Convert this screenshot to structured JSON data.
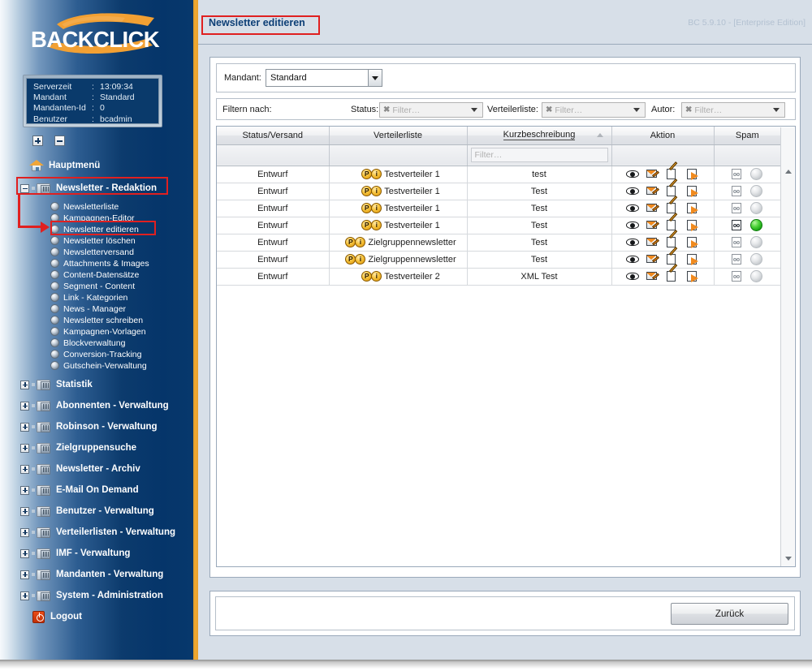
{
  "brand": {
    "logo_text": "BACKCLICK",
    "accent_orange": "#f0a63a",
    "dark_blue": "#05356a",
    "annotation_red": "#e02020"
  },
  "sidebar": {
    "info": [
      {
        "key": "Serverzeit",
        "sep": ":",
        "value": "13:09:34"
      },
      {
        "key": "Mandant",
        "sep": ":",
        "value": "Standard"
      },
      {
        "key": "Mandanten-Id",
        "sep": ":",
        "value": "0"
      },
      {
        "key": "Benutzer",
        "sep": ":",
        "value": "bcadmin"
      }
    ],
    "expand_all_label": "+",
    "collapse_all_label": "-",
    "home_label": "Hauptmenü",
    "section_label": "Newsletter - Redaktion",
    "sub_items": [
      {
        "label": "Newsletterliste"
      },
      {
        "label": "Kampagnen-Editor"
      },
      {
        "label": "Newsletter editieren"
      },
      {
        "label": "Newsletter löschen"
      },
      {
        "label": "Newsletterversand"
      },
      {
        "label": "Attachments & Images"
      },
      {
        "label": "Content-Datensätze"
      },
      {
        "label": "Segment - Content"
      },
      {
        "label": "Link - Kategorien"
      },
      {
        "label": "News - Manager"
      },
      {
        "label": "Newsletter schreiben"
      },
      {
        "label": "Kampagnen-Vorlagen"
      },
      {
        "label": "Blockverwaltung"
      },
      {
        "label": "Conversion-Tracking"
      },
      {
        "label": "Gutschein-Verwaltung"
      }
    ],
    "folders": [
      {
        "label": "Statistik"
      },
      {
        "label": "Abonnenten - Verwaltung"
      },
      {
        "label": "Robinson - Verwaltung"
      },
      {
        "label": "Zielgruppensuche"
      },
      {
        "label": "Newsletter - Archiv"
      },
      {
        "label": "E-Mail On Demand"
      },
      {
        "label": "Benutzer - Verwaltung"
      },
      {
        "label": "Verteilerlisten - Verwaltung"
      },
      {
        "label": "IMF - Verwaltung"
      },
      {
        "label": "Mandanten - Verwaltung"
      },
      {
        "label": "System - Administration"
      }
    ],
    "logout_label": "Logout"
  },
  "header": {
    "title": "Newsletter editieren",
    "version": "BC 5.9.10 - [Enterprise Edition]"
  },
  "mandant": {
    "label": "Mandant:",
    "value": "Standard"
  },
  "filters": {
    "title": "Filtern nach:",
    "status": {
      "label": "Status:",
      "placeholder": "Filter…",
      "clear": "✖"
    },
    "verteilerliste": {
      "label": "Verteilerliste:",
      "placeholder": "Filter…",
      "clear": "✖"
    },
    "autor": {
      "label": "Autor:",
      "placeholder": "Filter…",
      "clear": "✖"
    }
  },
  "table": {
    "columns": [
      {
        "label": "Status/Versand",
        "sorted": false
      },
      {
        "label": "Verteilerliste",
        "sorted": false
      },
      {
        "label": "Kurzbeschreibung",
        "sorted": true,
        "sort_dir": "asc"
      },
      {
        "label": "Aktion",
        "sorted": false
      },
      {
        "label": "Spam",
        "sorted": false
      }
    ],
    "column_filter_placeholder": "Filter…",
    "action_icons": [
      "eye-icon",
      "mail-edit-icon",
      "pencil-icon",
      "copy-icon"
    ],
    "rows": [
      {
        "status": "Entwurf",
        "verteilerliste": "Testverteiler 1",
        "badges": [
          "P",
          "i"
        ],
        "kurzbeschreibung": "test",
        "spam_active": false
      },
      {
        "status": "Entwurf",
        "verteilerliste": "Testverteiler 1",
        "badges": [
          "P",
          "i"
        ],
        "kurzbeschreibung": "Test",
        "spam_active": false
      },
      {
        "status": "Entwurf",
        "verteilerliste": "Testverteiler 1",
        "badges": [
          "P",
          "i"
        ],
        "kurzbeschreibung": "Test",
        "spam_active": false
      },
      {
        "status": "Entwurf",
        "verteilerliste": "Testverteiler 1",
        "badges": [
          "P",
          "i"
        ],
        "kurzbeschreibung": "Test",
        "spam_active": true
      },
      {
        "status": "Entwurf",
        "verteilerliste": "Zielgruppennewsletter",
        "badges": [
          "P",
          "i"
        ],
        "kurzbeschreibung": "Test",
        "spam_active": false
      },
      {
        "status": "Entwurf",
        "verteilerliste": "Zielgruppennewsletter",
        "badges": [
          "P",
          "i"
        ],
        "kurzbeschreibung": "Test",
        "spam_active": false
      },
      {
        "status": "Entwurf",
        "verteilerliste": "Testverteiler 2",
        "badges": [
          "P",
          "i"
        ],
        "kurzbeschreibung": "XML Test",
        "spam_active": false
      }
    ]
  },
  "footer": {
    "back_label": "Zurück"
  },
  "annotations": {
    "highlighted_title": "Newsletter editieren",
    "highlighted_section": "Newsletter - Redaktion",
    "highlighted_subitem": "Newsletter editieren"
  }
}
